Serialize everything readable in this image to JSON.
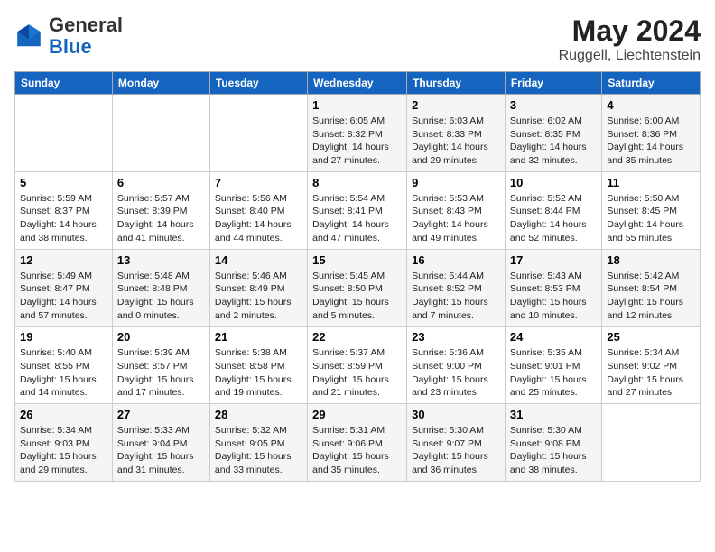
{
  "header": {
    "logo_general": "General",
    "logo_blue": "Blue",
    "month_year": "May 2024",
    "location": "Ruggell, Liechtenstein"
  },
  "days_of_week": [
    "Sunday",
    "Monday",
    "Tuesday",
    "Wednesday",
    "Thursday",
    "Friday",
    "Saturday"
  ],
  "weeks": [
    [
      {
        "day": "",
        "info": ""
      },
      {
        "day": "",
        "info": ""
      },
      {
        "day": "",
        "info": ""
      },
      {
        "day": "1",
        "info": "Sunrise: 6:05 AM\nSunset: 8:32 PM\nDaylight: 14 hours\nand 27 minutes."
      },
      {
        "day": "2",
        "info": "Sunrise: 6:03 AM\nSunset: 8:33 PM\nDaylight: 14 hours\nand 29 minutes."
      },
      {
        "day": "3",
        "info": "Sunrise: 6:02 AM\nSunset: 8:35 PM\nDaylight: 14 hours\nand 32 minutes."
      },
      {
        "day": "4",
        "info": "Sunrise: 6:00 AM\nSunset: 8:36 PM\nDaylight: 14 hours\nand 35 minutes."
      }
    ],
    [
      {
        "day": "5",
        "info": "Sunrise: 5:59 AM\nSunset: 8:37 PM\nDaylight: 14 hours\nand 38 minutes."
      },
      {
        "day": "6",
        "info": "Sunrise: 5:57 AM\nSunset: 8:39 PM\nDaylight: 14 hours\nand 41 minutes."
      },
      {
        "day": "7",
        "info": "Sunrise: 5:56 AM\nSunset: 8:40 PM\nDaylight: 14 hours\nand 44 minutes."
      },
      {
        "day": "8",
        "info": "Sunrise: 5:54 AM\nSunset: 8:41 PM\nDaylight: 14 hours\nand 47 minutes."
      },
      {
        "day": "9",
        "info": "Sunrise: 5:53 AM\nSunset: 8:43 PM\nDaylight: 14 hours\nand 49 minutes."
      },
      {
        "day": "10",
        "info": "Sunrise: 5:52 AM\nSunset: 8:44 PM\nDaylight: 14 hours\nand 52 minutes."
      },
      {
        "day": "11",
        "info": "Sunrise: 5:50 AM\nSunset: 8:45 PM\nDaylight: 14 hours\nand 55 minutes."
      }
    ],
    [
      {
        "day": "12",
        "info": "Sunrise: 5:49 AM\nSunset: 8:47 PM\nDaylight: 14 hours\nand 57 minutes."
      },
      {
        "day": "13",
        "info": "Sunrise: 5:48 AM\nSunset: 8:48 PM\nDaylight: 15 hours\nand 0 minutes."
      },
      {
        "day": "14",
        "info": "Sunrise: 5:46 AM\nSunset: 8:49 PM\nDaylight: 15 hours\nand 2 minutes."
      },
      {
        "day": "15",
        "info": "Sunrise: 5:45 AM\nSunset: 8:50 PM\nDaylight: 15 hours\nand 5 minutes."
      },
      {
        "day": "16",
        "info": "Sunrise: 5:44 AM\nSunset: 8:52 PM\nDaylight: 15 hours\nand 7 minutes."
      },
      {
        "day": "17",
        "info": "Sunrise: 5:43 AM\nSunset: 8:53 PM\nDaylight: 15 hours\nand 10 minutes."
      },
      {
        "day": "18",
        "info": "Sunrise: 5:42 AM\nSunset: 8:54 PM\nDaylight: 15 hours\nand 12 minutes."
      }
    ],
    [
      {
        "day": "19",
        "info": "Sunrise: 5:40 AM\nSunset: 8:55 PM\nDaylight: 15 hours\nand 14 minutes."
      },
      {
        "day": "20",
        "info": "Sunrise: 5:39 AM\nSunset: 8:57 PM\nDaylight: 15 hours\nand 17 minutes."
      },
      {
        "day": "21",
        "info": "Sunrise: 5:38 AM\nSunset: 8:58 PM\nDaylight: 15 hours\nand 19 minutes."
      },
      {
        "day": "22",
        "info": "Sunrise: 5:37 AM\nSunset: 8:59 PM\nDaylight: 15 hours\nand 21 minutes."
      },
      {
        "day": "23",
        "info": "Sunrise: 5:36 AM\nSunset: 9:00 PM\nDaylight: 15 hours\nand 23 minutes."
      },
      {
        "day": "24",
        "info": "Sunrise: 5:35 AM\nSunset: 9:01 PM\nDaylight: 15 hours\nand 25 minutes."
      },
      {
        "day": "25",
        "info": "Sunrise: 5:34 AM\nSunset: 9:02 PM\nDaylight: 15 hours\nand 27 minutes."
      }
    ],
    [
      {
        "day": "26",
        "info": "Sunrise: 5:34 AM\nSunset: 9:03 PM\nDaylight: 15 hours\nand 29 minutes."
      },
      {
        "day": "27",
        "info": "Sunrise: 5:33 AM\nSunset: 9:04 PM\nDaylight: 15 hours\nand 31 minutes."
      },
      {
        "day": "28",
        "info": "Sunrise: 5:32 AM\nSunset: 9:05 PM\nDaylight: 15 hours\nand 33 minutes."
      },
      {
        "day": "29",
        "info": "Sunrise: 5:31 AM\nSunset: 9:06 PM\nDaylight: 15 hours\nand 35 minutes."
      },
      {
        "day": "30",
        "info": "Sunrise: 5:30 AM\nSunset: 9:07 PM\nDaylight: 15 hours\nand 36 minutes."
      },
      {
        "day": "31",
        "info": "Sunrise: 5:30 AM\nSunset: 9:08 PM\nDaylight: 15 hours\nand 38 minutes."
      },
      {
        "day": "",
        "info": ""
      }
    ]
  ]
}
